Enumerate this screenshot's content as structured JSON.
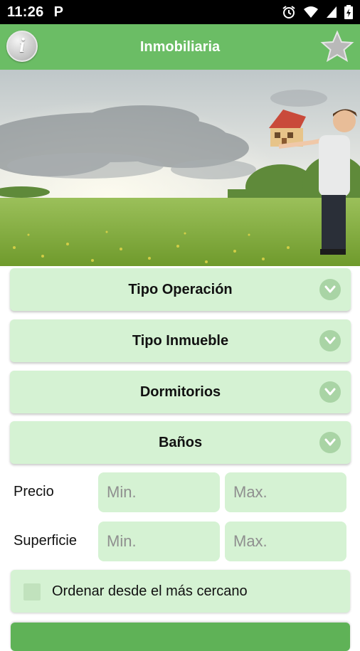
{
  "status_bar": {
    "time": "11:26",
    "notification_icon": "P",
    "icons": [
      "alarm-icon",
      "wifi-icon",
      "signal-icon",
      "battery-icon"
    ]
  },
  "app_bar": {
    "title": "Inmobiliaria",
    "info_icon_glyph": "i",
    "color": "#6bbd65"
  },
  "form": {
    "dropdowns": [
      {
        "label": "Tipo Operación"
      },
      {
        "label": "Tipo Inmueble"
      },
      {
        "label": "Dormitorios"
      },
      {
        "label": "Baños"
      }
    ],
    "price": {
      "label": "Precio",
      "min_placeholder": "Min.",
      "max_placeholder": "Max."
    },
    "surface": {
      "label": "Superficie",
      "min_placeholder": "Min.",
      "max_placeholder": "Max."
    },
    "order_nearest": {
      "label": "Ordenar desde el más cercano",
      "checked": false
    }
  },
  "colors": {
    "accent": "#6bbd65",
    "field_bg": "#d5f2d3",
    "chevron_bg": "#a9d4a5"
  }
}
